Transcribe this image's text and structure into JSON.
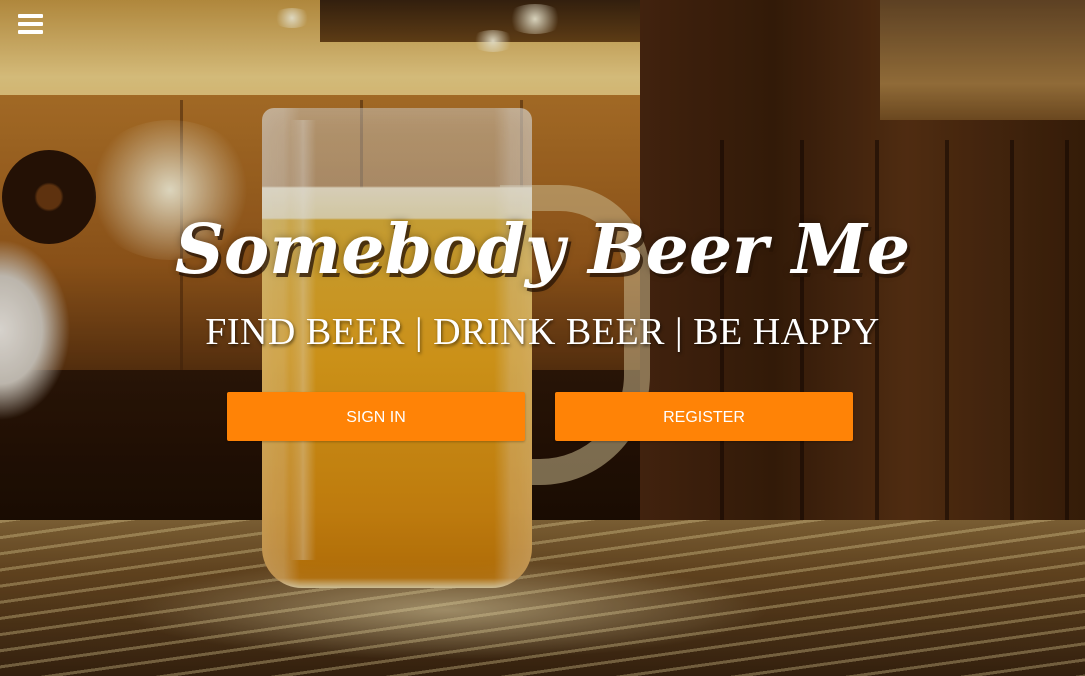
{
  "header": {
    "menu_icon": "hamburger-menu-icon"
  },
  "hero": {
    "title": "Somebody Beer Me",
    "tagline": "FIND BEER | DRINK BEER | BE HAPPY"
  },
  "actions": {
    "sign_in_label": "SIGN IN",
    "register_label": "REGISTER"
  },
  "colors": {
    "button_accent": "#ff8306",
    "text": "#ffffff"
  }
}
